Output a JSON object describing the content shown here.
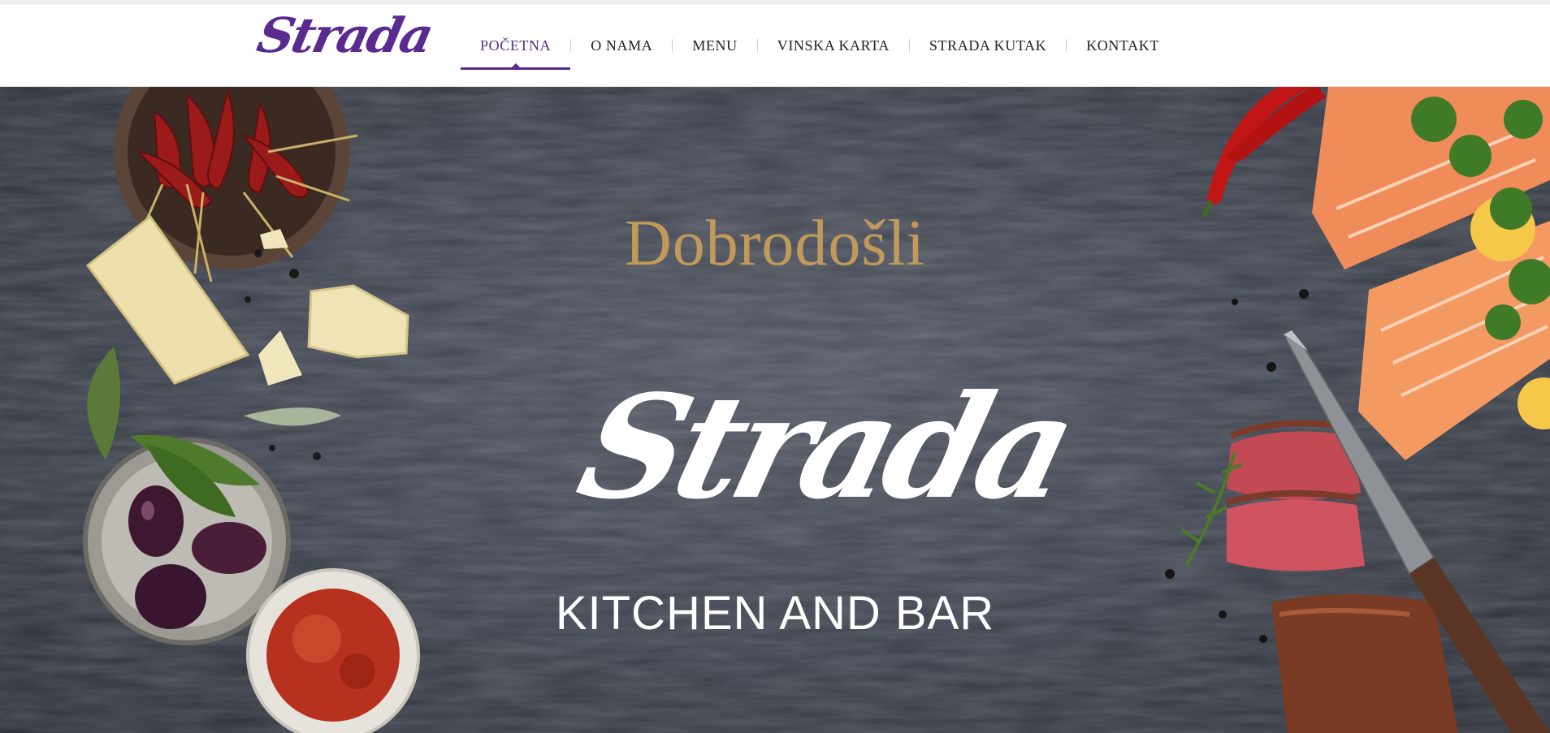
{
  "header": {
    "logo_text": "Strada",
    "logo_color": "#5a2a8f"
  },
  "nav": {
    "items": [
      {
        "label": "POČETNA",
        "active": true
      },
      {
        "label": "O NAMA",
        "active": false
      },
      {
        "label": "MENU",
        "active": false
      },
      {
        "label": "VINSKA KARTA",
        "active": false
      },
      {
        "label": "STRADA KUTAK",
        "active": false
      },
      {
        "label": "KONTAKT",
        "active": false
      }
    ],
    "active_color": "#5a2a8f"
  },
  "hero": {
    "welcome": "Dobrodošli",
    "welcome_color": "#c19a5b",
    "logo_text": "Strada",
    "tagline": "KITCHEN AND BAR"
  }
}
